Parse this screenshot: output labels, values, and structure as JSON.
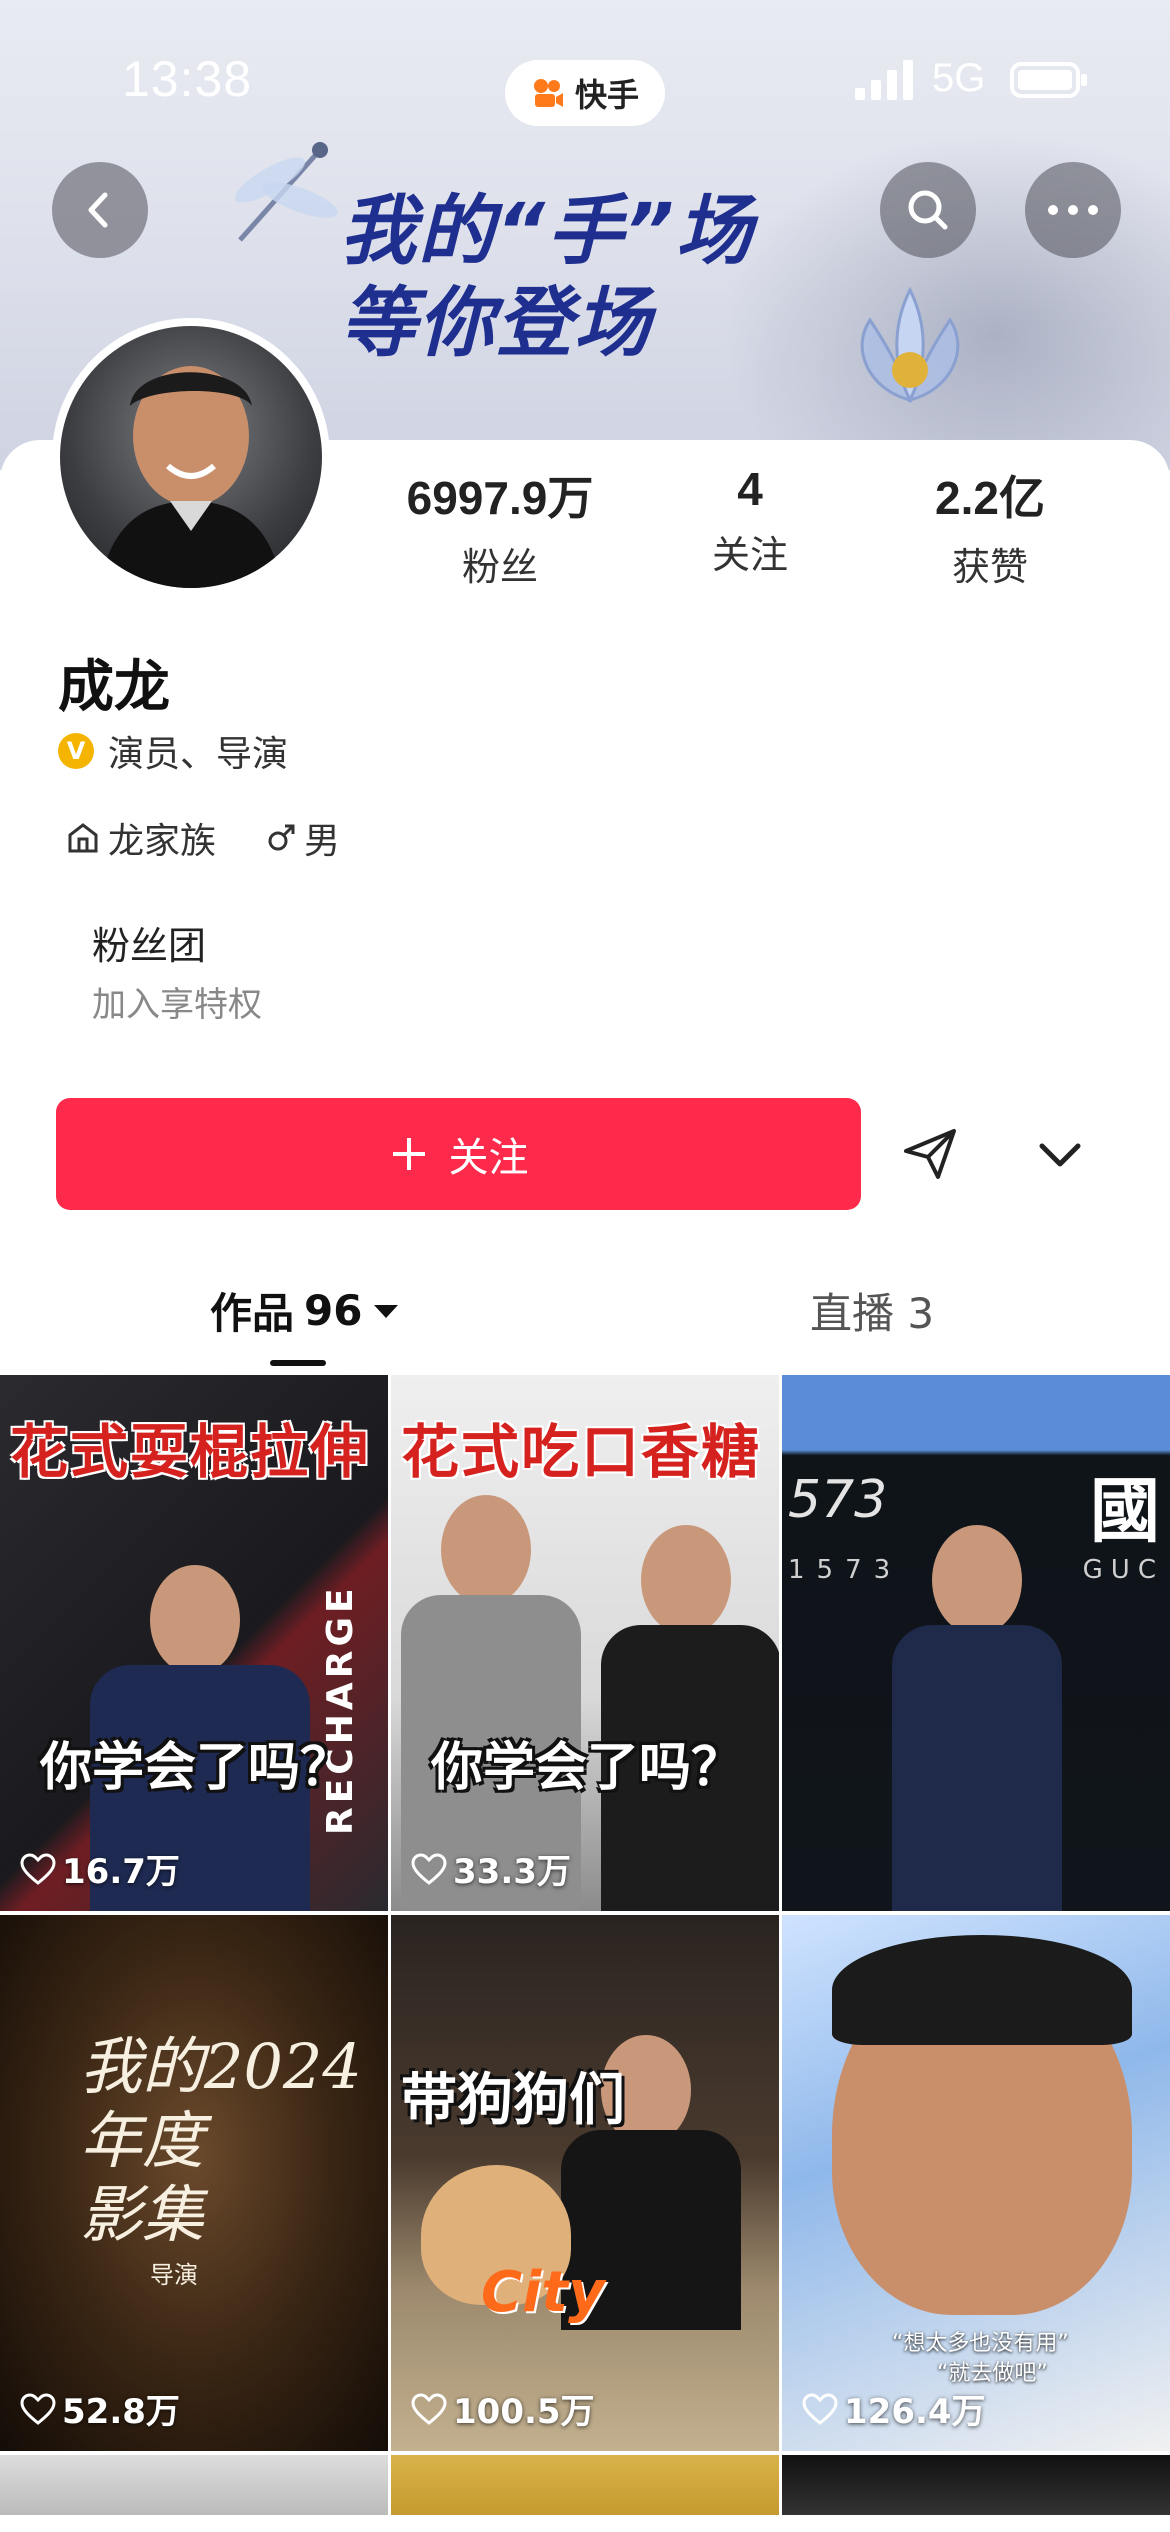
{
  "status_bar": {
    "time": "13:38",
    "app_name": "快手",
    "network": "5G"
  },
  "banner": {
    "slogan_line1": "我的“手”场",
    "slogan_line2": "等你登场"
  },
  "profile": {
    "name": "成龙",
    "verification": "演员、导演",
    "tags": [
      "龙家族",
      "男"
    ],
    "stats": [
      {
        "value": "6997.9万",
        "label": "粉丝"
      },
      {
        "value": "4",
        "label": "关注"
      },
      {
        "value": "2.2亿",
        "label": "获赞"
      }
    ],
    "fan_club": {
      "title": "粉丝团",
      "subtitle": "加入享特权"
    }
  },
  "actions": {
    "follow_label": "关注"
  },
  "tabs": {
    "works_label": "作品",
    "works_count": "96",
    "live_label": "直播 3"
  },
  "videos": [
    {
      "likes": "16.7万",
      "caption_top": "花式耍棍拉伸",
      "caption_mid": "你学会了吗？",
      "extra": "RECHARGE"
    },
    {
      "likes": "33.3万",
      "caption_top": "花式吃口香糖",
      "caption_mid": "你学会了吗？"
    },
    {
      "likes": "",
      "big_char": "國",
      "num": "573",
      "num2": "1573",
      "guc": "GUC"
    },
    {
      "likes": "52.8万",
      "handwriting": "我的2024\n年度\n影集",
      "sub": "导演"
    },
    {
      "likes": "100.5万",
      "caption": "带狗狗们",
      "city": "City"
    },
    {
      "likes": "126.4万",
      "quote1": "“想太多也没有用”",
      "quote2": "“就去做吧”"
    }
  ],
  "colors": {
    "accent": "#fe2a4b",
    "brand_orange": "#ff7a1a",
    "slogan": "#1f2f8f"
  }
}
